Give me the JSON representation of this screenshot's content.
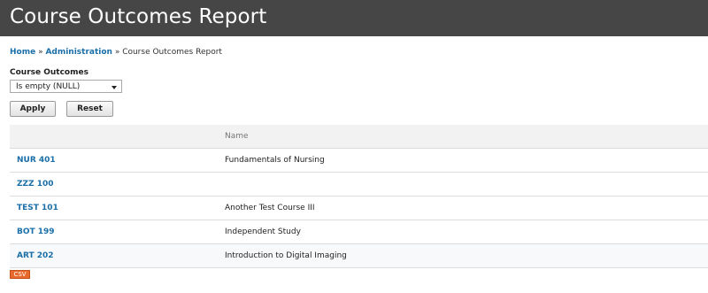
{
  "header": {
    "title": "Course Outcomes Report"
  },
  "breadcrumb": {
    "home": "Home",
    "sep1": " » ",
    "administration": "Administration",
    "sep2": " » ",
    "current": "Course Outcomes Report"
  },
  "filter": {
    "label": "Course Outcomes",
    "selected": "Is empty (NULL)"
  },
  "buttons": {
    "apply": "Apply",
    "reset": "Reset"
  },
  "table": {
    "columns": [
      "",
      "Name"
    ],
    "rows": [
      {
        "code": "NUR 401",
        "name": "Fundamentals of Nursing"
      },
      {
        "code": "ZZZ 100",
        "name": ""
      },
      {
        "code": "TEST 101",
        "name": "Another Test Course III"
      },
      {
        "code": "BOT 199",
        "name": "Independent Study"
      },
      {
        "code": "ART 202",
        "name": "Introduction to Digital Imaging"
      }
    ]
  },
  "export": {
    "csv": "CSV"
  },
  "colors": {
    "header_bg": "#464646",
    "link": "#1a6fa8",
    "csv_badge": "#e8692c"
  }
}
